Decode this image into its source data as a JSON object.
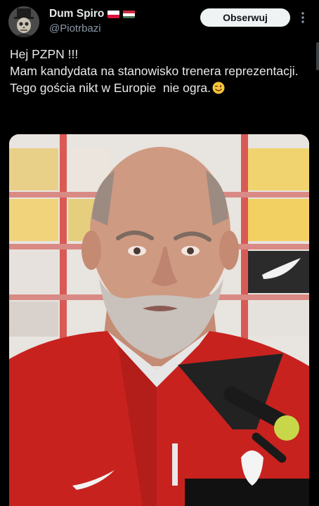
{
  "author": {
    "display_name": "Dum Spiro",
    "handle": "@Piotrbazi",
    "flags": [
      "poland-flag",
      "hungary-flag"
    ],
    "avatar": "avatar-icon"
  },
  "follow_button": {
    "label": "Obserwuj"
  },
  "more_menu": {
    "icon": "more-vertical-icon"
  },
  "tweet": {
    "lines": [
      "Hej PZPN !!!",
      "Mam kandydata na stanowisko trenera reprezentacji.",
      "Tego gościa nikt w Europie  nie ogra."
    ],
    "emoji": "winking-face-icon"
  },
  "media": {
    "type": "photo",
    "description_icon": "press-conference-photo"
  },
  "colors": {
    "background": "#000000",
    "text": "#e7e9ea",
    "secondary_text": "#8b98a5",
    "button_bg": "#eff3f4",
    "button_text": "#0f1419"
  }
}
